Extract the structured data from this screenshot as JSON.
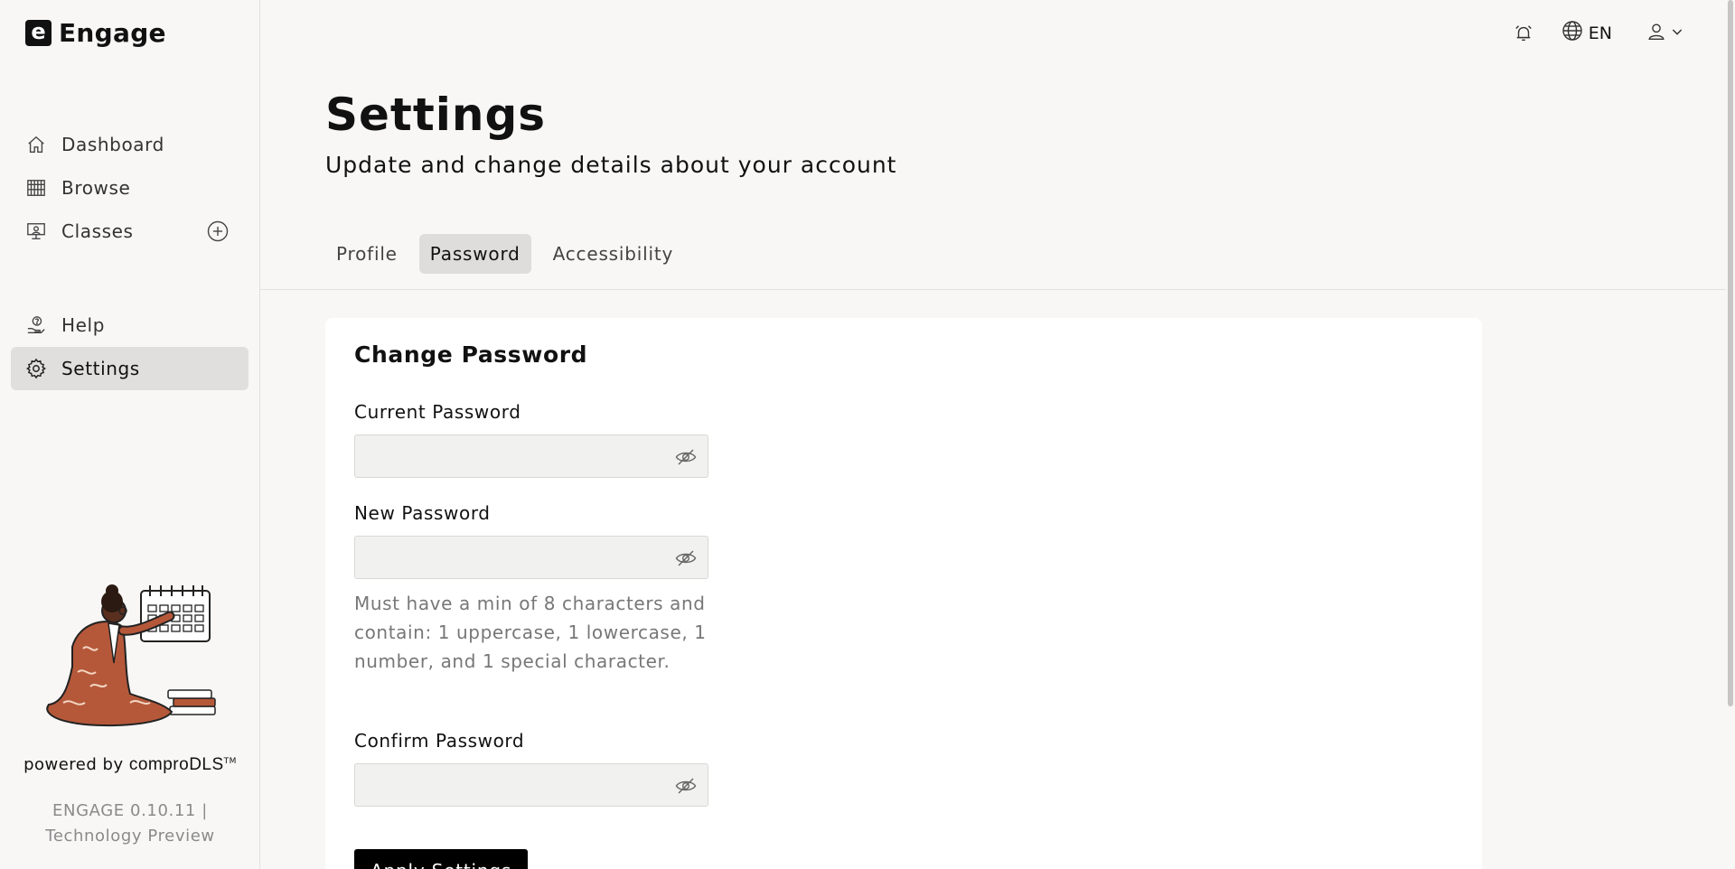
{
  "brand": {
    "logo_letter": "e",
    "name": "Engage"
  },
  "sidebar": {
    "items": [
      {
        "label": "Dashboard",
        "icon": "home-icon"
      },
      {
        "label": "Browse",
        "icon": "books-shelf-icon"
      },
      {
        "label": "Classes",
        "icon": "classroom-icon",
        "action_icon": "add-circle-icon"
      },
      {
        "label": "Help",
        "icon": "help-hand-icon"
      },
      {
        "label": "Settings",
        "icon": "gear-icon",
        "active": true
      }
    ],
    "powered_prefix": "powered by",
    "powered_brand": "comproDLS",
    "powered_tm": "TM",
    "version_line1": "ENGAGE 0.10.11 |",
    "version_line2": "Technology Preview"
  },
  "header": {
    "language": "EN",
    "icons": [
      "alarm-bell-icon",
      "globe-icon",
      "user-icon",
      "chevron-down-icon"
    ]
  },
  "page": {
    "title": "Settings",
    "subtitle": "Update and change details about your account"
  },
  "tabs": [
    {
      "label": "Profile",
      "active": false
    },
    {
      "label": "Password",
      "active": true
    },
    {
      "label": "Accessibility",
      "active": false
    }
  ],
  "form": {
    "title": "Change Password",
    "current_label": "Current Password",
    "current_value": "",
    "new_label": "New Password",
    "new_value": "",
    "hint": "Must have a min of 8 characters and contain: 1 uppercase, 1 lowercase, 1 number, and 1 special character.",
    "confirm_label": "Confirm Password",
    "confirm_value": "",
    "apply_label": "Apply Settings"
  },
  "colors": {
    "accent": "#000000",
    "active_bg": "#e0dfdd",
    "page_bg": "#f8f7f6"
  }
}
